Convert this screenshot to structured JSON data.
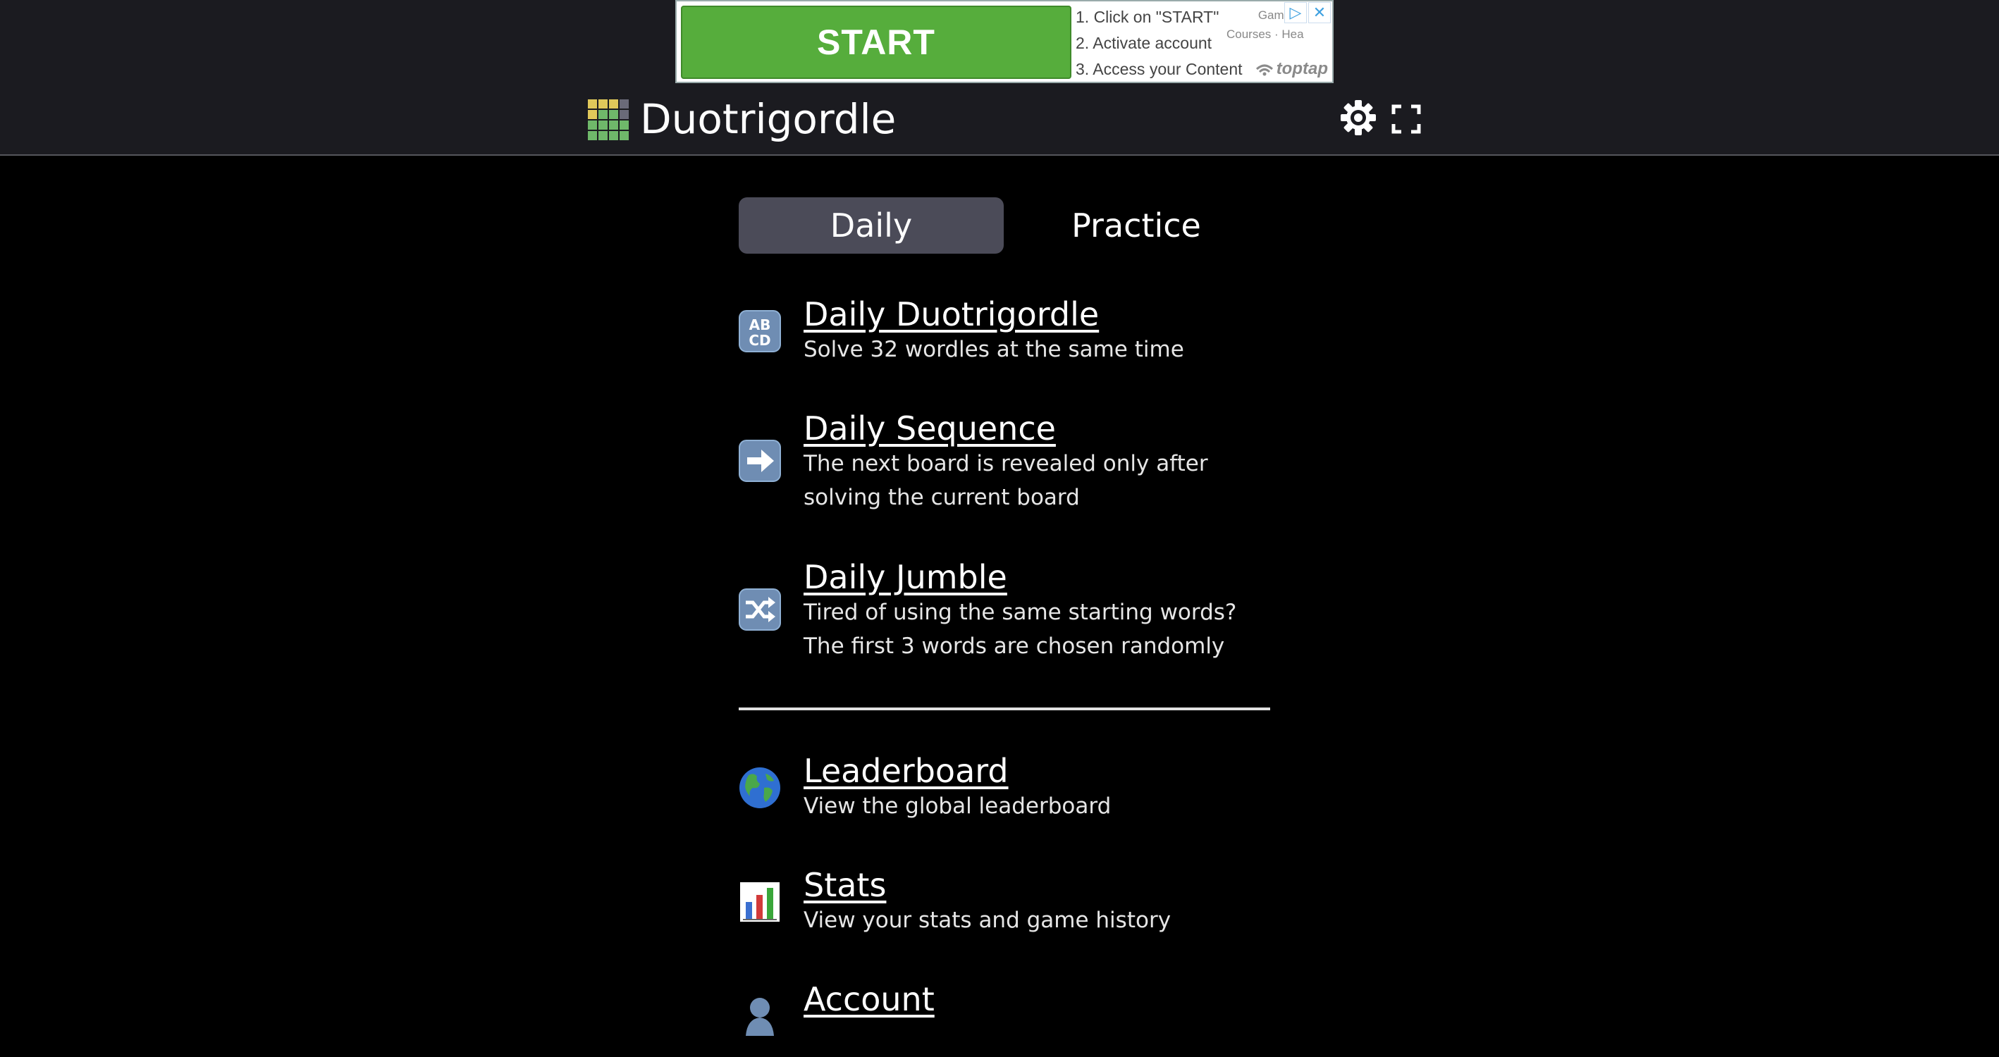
{
  "ad": {
    "start_label": "START",
    "steps": [
      "1. Click on \"START\"",
      "2. Activate account",
      "3. Access your Content"
    ],
    "categories": [
      "Games · ",
      "Courses · Health"
    ],
    "brand": "toptap",
    "close_symbol": "✕",
    "adchoices_symbol": "▷"
  },
  "header": {
    "title": "Duotrigordle",
    "icons": [
      "logo-grid-icon",
      "gear-icon",
      "fullscreen-icon"
    ],
    "logo_colors": [
      "#e0c85a",
      "#e0c85a",
      "#e0c85a",
      "#6a6a78",
      "#e0c85a",
      "#6fb86a",
      "#6fb86a",
      "#6a6a78",
      "#6fb86a",
      "#6fb86a",
      "#6fb86a",
      "#6fb86a",
      "#6fb86a",
      "#6fb86a",
      "#6fb86a",
      "#6fb86a"
    ]
  },
  "tabs": [
    {
      "label": "Daily",
      "active": true
    },
    {
      "label": "Practice",
      "active": false
    }
  ],
  "items": [
    {
      "title": "Daily Duotrigordle",
      "description": "Solve 32 wordles at the same time",
      "icon": "abcd-icon"
    },
    {
      "title": "Daily Sequence",
      "description": "The next board is revealed only after solving the current board",
      "icon": "right-arrow-icon"
    },
    {
      "title": "Daily Jumble",
      "description": "Tired of using the same starting words? The first 3 words are chosen randomly",
      "icon": "shuffle-icon"
    },
    {
      "title": "Leaderboard",
      "description": "View the global leaderboard",
      "icon": "globe-icon"
    },
    {
      "title": "Stats",
      "description": "View your stats and game history",
      "icon": "bar-chart-icon"
    },
    {
      "title": "Account",
      "description": "",
      "icon": "person-icon"
    }
  ],
  "colors": {
    "topbar": "#1b1b20",
    "active_tab": "#4b4b58",
    "ad_green": "#56ad3c"
  }
}
